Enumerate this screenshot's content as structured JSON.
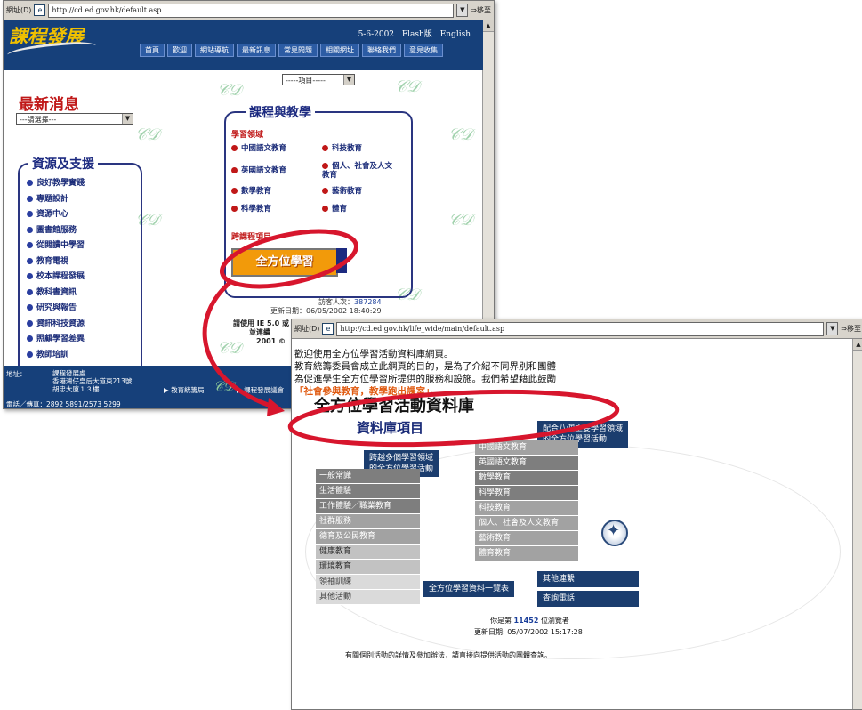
{
  "colors": {
    "accent_red": "#d7162d",
    "navy": "#16407a",
    "orange": "#f29a0a"
  },
  "win1": {
    "addr_label": "網址(D)",
    "url": "http://cd.ed.gov.hk/default.asp",
    "go": "移至",
    "topright": {
      "date": "5-6-2002",
      "flash": "Flash版",
      "english": "English"
    },
    "logo": "課程發展",
    "nav": [
      "首頁",
      "歡迎",
      "網站導航",
      "最新訊息",
      "常見問題",
      "相關網址",
      "聯絡我們",
      "意見收集"
    ],
    "item_select": "-----項目-----",
    "news_title": "最新消息",
    "news_select": "---請選擇---",
    "resources_title": "資源及支援",
    "resources": [
      "良好教學實踐",
      "專題設計",
      "資源中心",
      "圖書館服務",
      "從閱讀中學習",
      "教育電視",
      "校本課程發展",
      "教科書資訊",
      "研究與報告",
      "資訊科技資源",
      "照顧學習差異",
      "教師培訓"
    ],
    "ct_title": "課程與教學",
    "kla_head": "學習領域",
    "kla_left": [
      "中國語文教育",
      "英國語文教育",
      "數學教育",
      "科學教育"
    ],
    "kla_right": [
      "科技教育",
      "個人、社會及人文教育",
      "藝術教育",
      "體育"
    ],
    "cross_head": "跨課程項目",
    "allround": "全方位學習",
    "visitors_label": "訪客人次：",
    "visitors_value": "387284",
    "updated": "更新日期：06/05/2002 18:40:29",
    "support": [
      "請使用 IE 5.0 或",
      "並連續",
      "2001 ©"
    ],
    "footer": {
      "addr_label": "地址：",
      "addr_lines": [
        "課程發展處",
        "香港灣仔皇后大道東213號",
        "胡忠大廈１３樓"
      ],
      "phone": "電話／傳真：2892 5891/2573 5299",
      "link1": "教育統籌局",
      "link2": "課程發展議會"
    }
  },
  "win2": {
    "addr_label": "網址(D)",
    "url": "http://cd.ed.gov.hk/life_wide/main/default.asp",
    "go": "移至",
    "welcome": [
      "歡迎使用全方位學習活動資料庫網頁。",
      "教育統籌委員會成立此網頁的目的，是為了介紹不同界別和團體",
      "為促進學生全方位學習所提供的服務和設施。我們希望藉此鼓勵"
    ],
    "slogan": "「社會參與教育，教學跑出課室」。",
    "db_title": "全方位學習活動資料庫",
    "db_sub": "資料庫項目",
    "box_kla": [
      "配合八個主要學習領域",
      "的全方位學習活動"
    ],
    "box_cross": [
      "跨越多個學習領域",
      "的全方位學習活動"
    ],
    "kla_list": [
      "中國語文教育",
      "英國語文教育",
      "數學教育",
      "科學教育",
      "科技教育",
      "個人、社會及人文教育",
      "藝術教育",
      "體育教育"
    ],
    "cross_list": [
      "一般常識",
      "生活體驗",
      "工作體驗／職業教育",
      "社群服務",
      "德育及公民教育",
      "健康教育",
      "環境教育",
      "領袖訓練",
      "其他活動"
    ],
    "overview": "全方位學習資料一覽表",
    "other_links": "其他連繫",
    "enquiry_phone": "查詢電話",
    "counter_pre": "你是第",
    "counter_value": "11452",
    "counter_post": "位瀏覽者",
    "updated": "更新日期: 05/07/2002 15:17:28",
    "enquiry": "有關個別活動的詳情及參加辦法，請直接向提供活動的團體查詢。"
  }
}
